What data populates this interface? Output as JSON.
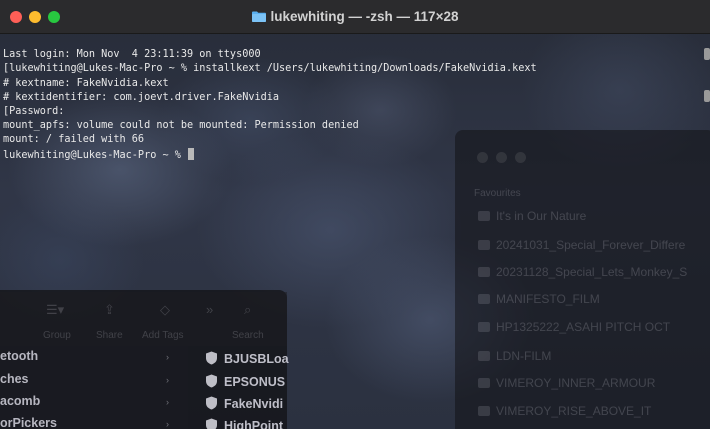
{
  "window": {
    "title": "lukewhiting — -zsh — 117×28"
  },
  "terminal": {
    "lines": [
      "Last login: Mon Nov  4 23:11:39 on ttys000",
      "[lukewhiting@Lukes-Mac-Pro ~ % installkext /Users/lukewhiting/Downloads/FakeNvidia.kext",
      "# kextname: FakeNvidia.kext",
      "# kextidentifier: com.joevt.driver.FakeNvidia",
      "[Password:",
      "mount_apfs: volume could not be mounted: Permission denied",
      "mount: / failed with 66",
      "lukewhiting@Lukes-Mac-Pro ~ % "
    ]
  },
  "finder_bg": {
    "favorites_label": "Favourites",
    "items": [
      "It's in Our Nature",
      "20241031_Special_Forever_Differe",
      "20231128_Special_Lets_Monkey_S",
      "MANIFESTO_FILM",
      "HP1325222_ASAHI PITCH OCT",
      "LDN-FILM",
      "VIMEROY_INNER_ARMOUR",
      "VIMEROY_RISE_ABOVE_IT"
    ]
  },
  "finder_bottom": {
    "toolbar": [
      "Group",
      "Share",
      "Add Tags",
      "Search"
    ],
    "sidebar": [
      "etooth",
      "ches",
      "acomb",
      "orPickers"
    ],
    "files": [
      "BJUSBLoa",
      "EPSONUS",
      "FakeNvidi",
      "HighPoint"
    ]
  },
  "colors": {
    "close": "#fe5f57",
    "minimize": "#febc2e",
    "zoom": "#28c840",
    "folder": "#5ab0f0"
  }
}
